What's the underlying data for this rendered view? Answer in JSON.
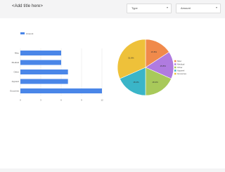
{
  "header": {
    "title": "<Add title here>",
    "type_select": {
      "value": "Type"
    },
    "amount_select": {
      "value": "Amount"
    }
  },
  "colors": {
    "bar": "#4a86e8",
    "pie": [
      "#f08a4b",
      "#b07be0",
      "#a8c95a",
      "#3ab5c8",
      "#eec13a"
    ]
  },
  "chart_data": [
    {
      "type": "bar",
      "orientation": "horizontal",
      "categories": [
        "Misc",
        "Medical",
        "Other",
        "Apparel",
        "Groceries"
      ],
      "values": [
        6,
        6,
        7,
        7,
        12
      ],
      "legend": [
        "Amount"
      ],
      "legend_position": "top-left",
      "xlim": [
        0,
        12
      ],
      "xticks": [
        "0",
        "3",
        "6",
        "9",
        "12"
      ],
      "grid": true
    },
    {
      "type": "pie",
      "slices": [
        {
          "label": "Misc",
          "value": 15.8
        },
        {
          "label": "Medical",
          "value": 15.8
        },
        {
          "label": "Other",
          "value": 18.4
        },
        {
          "label": "Apparel",
          "value": 18.4
        },
        {
          "label": "Groceries",
          "value": 31.6
        }
      ],
      "slice_labels": [
        "15.8%",
        "15.8%",
        "18.4%",
        "18.4%",
        "31.6%"
      ],
      "legend": [
        "Misc",
        "Medical",
        "Other",
        "Apparel",
        "Groceries"
      ],
      "legend_position": "right"
    }
  ]
}
